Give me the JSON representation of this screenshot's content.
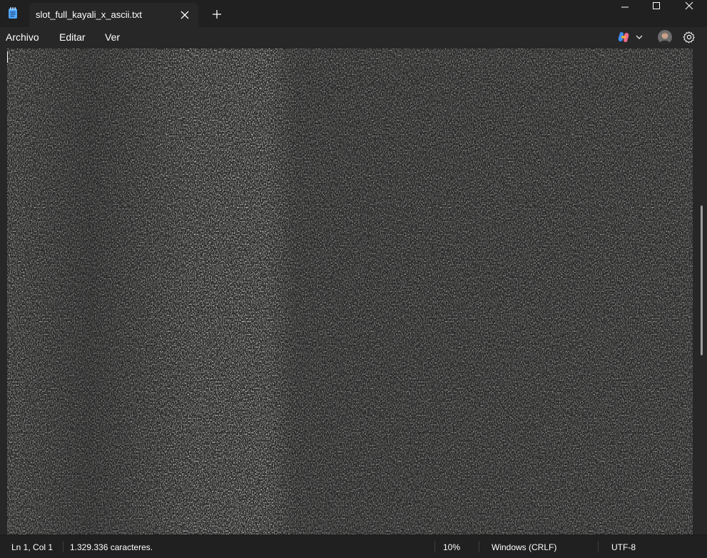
{
  "window": {
    "tab_title": "slot_full_kayali_x_ascii.txt",
    "controls": [
      "minimize-icon",
      "maximize-icon",
      "close-icon"
    ]
  },
  "menu": {
    "items": [
      {
        "label": "Archivo"
      },
      {
        "label": "Editar"
      },
      {
        "label": "Ver"
      }
    ],
    "right_icons": [
      "copilot-icon",
      "chevron-down-icon",
      "avatar",
      "gear-icon"
    ]
  },
  "editor": {
    "content_description_icon": "ascii-art-text",
    "text_color": "#d6d6d6",
    "background_color": "#272727"
  },
  "status": {
    "position": "Ln 1, Col 1",
    "char_count": "1.329.336 caracteres.",
    "zoom": "10%",
    "line_ending": "Windows (CRLF)",
    "encoding": "UTF-8"
  },
  "colors": {
    "titlebar": "#202020",
    "tab_active": "#272727",
    "notepad_icon": "#4fa6ff",
    "scroll_thumb": "#9a9a9a"
  }
}
